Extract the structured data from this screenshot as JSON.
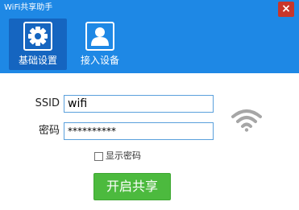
{
  "window": {
    "title": "WiFi共享助手",
    "close_label": "×"
  },
  "nav": {
    "tabs": [
      {
        "label": "基础设置",
        "icon": "gear-icon",
        "active": true
      },
      {
        "label": "接入设备",
        "icon": "user-icon",
        "active": false
      }
    ]
  },
  "form": {
    "ssid_label": "SSID",
    "ssid_value": "wifi",
    "password_label": "密码",
    "password_value": "**********",
    "show_password_label": "显示密码",
    "show_password_checked": false,
    "start_button_label": "开启共享"
  },
  "status": {
    "wifi_icon": "wifi-signal-icon"
  },
  "colors": {
    "header": "#1e88e5",
    "active_tab": "#1565c0",
    "close": "#c8362b",
    "input_border": "#5aa0dc",
    "start_button": "#4cba3e",
    "wifi_icon": "#a6a6a6"
  }
}
